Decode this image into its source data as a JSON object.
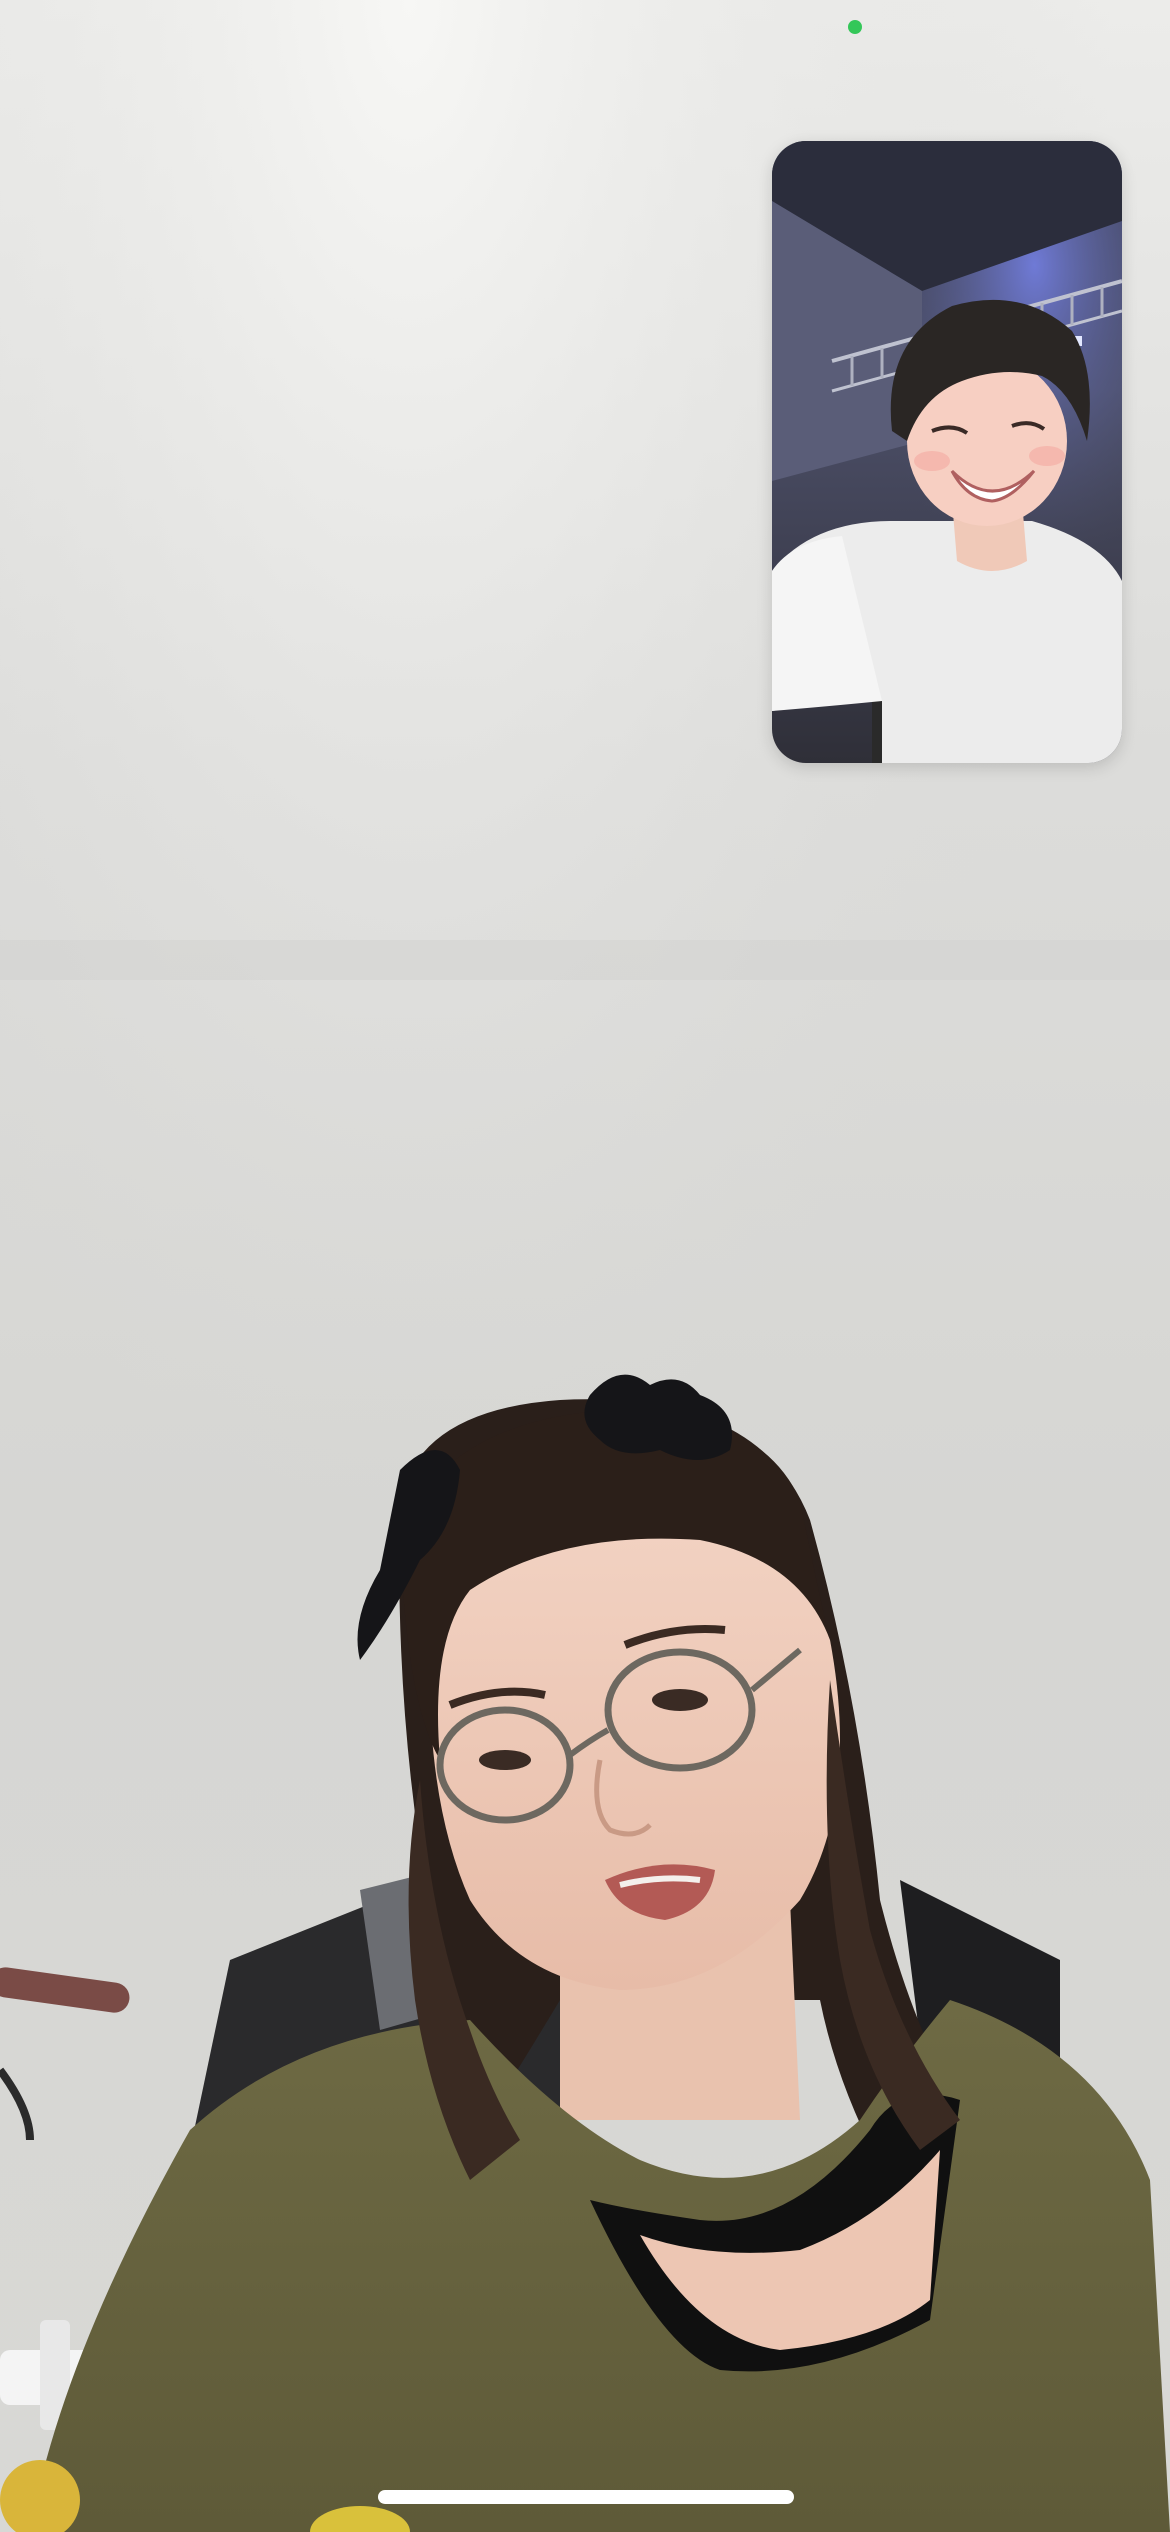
{
  "app": {
    "type": "video-call"
  },
  "remote_video": {
    "subject": "remote-participant-video",
    "background_color": "#dcdcda"
  },
  "self_view": {
    "subject": "self-camera-preview"
  },
  "status": {
    "camera_active_color": "#34c759"
  },
  "home_indicator": {
    "color": "#ffffff"
  }
}
